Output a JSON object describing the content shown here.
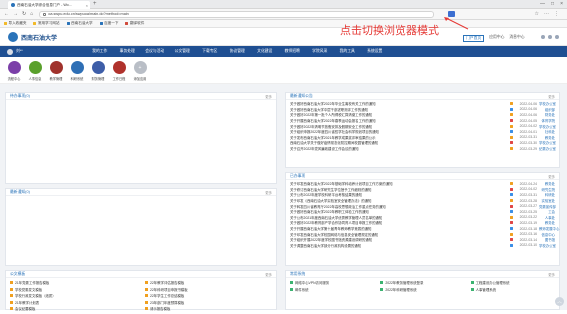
{
  "browser": {
    "tab_title": "西南石油大学综合信息门户 - Wo...",
    "tab_close": "×",
    "tab_add": "+",
    "window_controls": [
      "—",
      "□",
      "×"
    ],
    "nav_buttons": [
      "←",
      "→",
      "↻",
      "⌂"
    ],
    "url": "oa.swpu.edu.cn/swpuoa/main.do?method=main",
    "address_icons": [
      "☆",
      "⋯",
      "⋮"
    ],
    "bookmarks": [
      {
        "label": "导入收藏夹",
        "icon": "folder-icon"
      },
      {
        "label": "常用学习网站",
        "icon": "folder-icon"
      },
      {
        "label": "西南石油大学",
        "icon": "school-icon"
      },
      {
        "label": "百度一下",
        "icon": "baidu-icon"
      },
      {
        "label": "翻译软件",
        "icon": "translate-icon"
      }
    ]
  },
  "annotation": {
    "text": "点击切换浏览器模式",
    "color": "#e53935"
  },
  "site": {
    "logo_text": "西南石油大学",
    "header_tabs": [
      "门户首页",
      "应用中心",
      "消息中心"
    ],
    "user_name": "刘**",
    "nav": [
      "我的工作",
      "事务处理",
      "会议与活动",
      "公文管理",
      "下载专区",
      "协议管理",
      "文化建设",
      "教师招聘",
      "学院风采",
      "我的工具",
      "系统设置"
    ],
    "quick_apps": [
      {
        "label": "流程中心",
        "color": "#7b3fa8"
      },
      {
        "label": "人事信息",
        "color": "#5aa02c"
      },
      {
        "label": "教学管理",
        "color": "#a0322c"
      },
      {
        "label": "科研系统",
        "color": "#2f6fb5"
      },
      {
        "label": "财务管理",
        "color": "#3e5ea8"
      },
      {
        "label": "工作日程",
        "color": "#b0322c"
      },
      {
        "label": "添加应用",
        "color": "#b9bec6",
        "symbol": "+"
      }
    ]
  },
  "panels": {
    "todo": {
      "title": "待办事项(0)",
      "more": "更多"
    },
    "recent": {
      "title": "最新通知(0)",
      "more": "更多"
    },
    "announce": {
      "title": "最新通知公告",
      "more": "更多",
      "items": [
        {
          "title": "关于做好西南石油大学2022年毕业生离校有关工作的通知",
          "date": "2022-04-06",
          "src": "学校办公室"
        },
        {
          "title": "关于做好西南石油大学中层干部述职测评工作的通知",
          "date": "2022-04-06",
          "src": "组织部"
        },
        {
          "title": "关于做好2022年第一批个人所得税汇算清缴工作的通知",
          "date": "2022-04-06",
          "src": "财务处"
        },
        {
          "title": "关于开展西南石油大学2022年春季运动会报名工作的通知",
          "date": "2022-04-05",
          "src": "体育学院"
        },
        {
          "title": "关于做好2022年清明节放假安排及假期安全工作的通知",
          "date": "2022-04-02",
          "src": "学校办公室"
        },
        {
          "title": "关于组织申报2022年度四川省哲学社会科学规划项目的通知",
          "date": "2022-04-01",
          "src": "社科处"
        },
        {
          "title": "关于发布西南石油大学2021年教学成果奖评审结果的公示",
          "date": "2022-03-31",
          "src": "教务处"
        },
        {
          "title": "西南石油大学关于做好疫情常态化防控期间校园管理的通知",
          "date": "2022-03-30",
          "src": "学校办公室"
        },
        {
          "title": "关于召开2022年党风廉政建设工作会议的通知",
          "date": "2022-03-29",
          "src": "纪委办公室"
        }
      ]
    },
    "docs": {
      "title": "已办事项",
      "more": "更多",
      "items": [
        {
          "title": "关于印发西南石油大学2022年基础学科培养计划项目工作方案的通知",
          "date": "2022-04-24",
          "src": "教务处"
        },
        {
          "title": "关于修订西南石油大学研究生学位授予工作细则的通知",
          "date": "2022-04-02",
          "src": "研究生院"
        },
        {
          "title": "关于公布2022年度学校科研平台考核结果的通知",
          "date": "2022-03-31",
          "src": "科研处"
        },
        {
          "title": "关于印发《西南石油大学实验室安全管理办法》的通知",
          "date": "2022-03-28",
          "src": "实验室处"
        },
        {
          "title": "关于转发四川省教育厅2022年高校思想政治工作重点任务的通知",
          "date": "2022-03-27",
          "src": "党委宣传部"
        },
        {
          "title": "关于做好西南石油大学2022年教职工体检工作的通知",
          "date": "2022-03-25",
          "src": "工会"
        },
        {
          "title": "关于公布2021年度西南石油大学优秀教学管理人员名单的通知",
          "date": "2022-03-22",
          "src": "人事处"
        },
        {
          "title": "关于做好2022年教育部产学合作协同育人项目申报工作的通知",
          "date": "2022-03-19",
          "src": "教务处"
        },
        {
          "title": "关于开展西南石油大学第十届青年教师教学竞赛的通知",
          "date": "2022-03-18",
          "src": "教师发展中心"
        },
        {
          "title": "关于印发西南石油大学校园网络与信息安全管理规定的通知",
          "date": "2022-03-16",
          "src": "信息中心"
        },
        {
          "title": "关于组织开展2022年度学校图书馆资源建设调研的通知",
          "date": "2022-03-14",
          "src": "图书馆"
        },
        {
          "title": "关于调整西南石油大学部分行政机构设置的通知",
          "date": "2022-03-10",
          "src": "学校办公室"
        }
      ]
    },
    "links": {
      "title": "公文模板",
      "more": "更多",
      "items": [
        "21年党委工作报告模板",
        "22年教学评估报告模板",
        "学校党委发文模板",
        "22年科研项目申报书模板",
        "学校行政发文模板（纸质）",
        "22年学生工作总结模板",
        "21年教学计划表",
        "23年部门年度预算模板",
        "会议纪要模板",
        "请示报告模板"
      ]
    },
    "tools": {
      "title": "常用系统",
      "more": "更多",
      "items": [
        "网络中心VPN访问服务",
        "2022年教务管理系统登录",
        "工程建设办公管理系统",
        "邮件系统",
        "2022年科研管理系统",
        "人事管理系统"
      ]
    }
  }
}
